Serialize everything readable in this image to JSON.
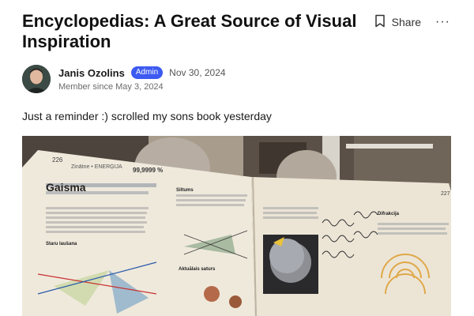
{
  "post": {
    "title": "Encyclopedias: A Great Source of Visual Inspiration",
    "share_label": "Share",
    "more_label": "···",
    "body": "Just a reminder :) scrolled my sons book yesterday"
  },
  "author": {
    "name": "Janis Ozolins",
    "badge": "Admin",
    "date": "Nov 30, 2024",
    "member_since": "Member since May 3, 2024"
  },
  "book": {
    "page_left": "226",
    "section": "Zinātne • ENERĢIJA",
    "percent": "99,9999 %",
    "heading": "Gaisma",
    "sub1": "Siltums",
    "sub2": "Staru laušana",
    "sub3": "Aktuālais saturs",
    "page_right": "227",
    "right_heading": "Difrakcija"
  },
  "colors": {
    "accent": "#3d5af1"
  }
}
